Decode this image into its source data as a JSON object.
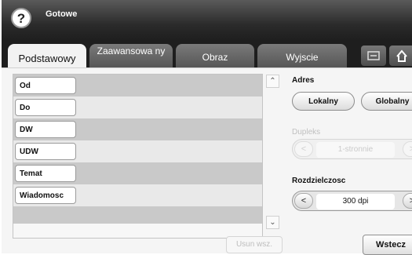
{
  "header": {
    "status": "Gotowe"
  },
  "tabs": [
    {
      "label": "Podstawowy"
    },
    {
      "label": "Zaawansowa ny"
    },
    {
      "label": "Obraz"
    },
    {
      "label": "Wyjscie"
    }
  ],
  "fields": [
    {
      "label": "Od"
    },
    {
      "label": "Do"
    },
    {
      "label": "DW"
    },
    {
      "label": "UDW"
    },
    {
      "label": "Temat"
    },
    {
      "label": "Wiadomosc"
    }
  ],
  "buttons": {
    "delete_all": "Usun wsz.",
    "back": "Wstecz"
  },
  "address": {
    "label": "Adres",
    "local": "Lokalny",
    "global": "Globalny"
  },
  "duplex": {
    "label": "Dupleks",
    "value": "1-stronnie"
  },
  "resolution": {
    "label": "Rozdzielczosc",
    "value": "300 dpi"
  }
}
